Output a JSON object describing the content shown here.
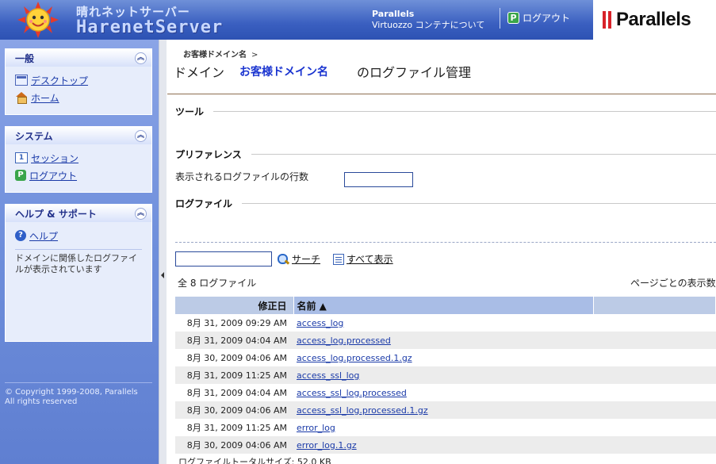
{
  "header": {
    "brand_ja": "晴れネットサーバー",
    "brand_en": "HarenetServer",
    "product_name": "Parallels",
    "about_text": "Virtuozzo コンテナについて",
    "logout_label": "ログアウト",
    "vendor_logo": "Parallels",
    "colors": {
      "header_blue": "#3a5fc0",
      "vendor_red": "#d8232a"
    }
  },
  "sidebar": {
    "panels": [
      {
        "title": "一般",
        "items": [
          {
            "label": "デスクトップ",
            "icon": "desktop-icon"
          },
          {
            "label": "ホーム",
            "icon": "home-icon"
          }
        ]
      },
      {
        "title": "システム",
        "items": [
          {
            "label": "セッション",
            "icon": "session-icon"
          },
          {
            "label": "ログアウト",
            "icon": "logout-icon"
          }
        ]
      },
      {
        "title": "ヘルプ & サポート",
        "items": [
          {
            "label": "ヘルプ",
            "icon": "help-icon"
          }
        ],
        "help_text": "ドメインに関係したログファイルが表示されています"
      }
    ],
    "copyright": "© Copyright 1999-2008, Parallels\nAll rights reserved"
  },
  "main": {
    "breadcrumb": {
      "item": "お客様ドメイン名",
      "separator": ">"
    },
    "title": {
      "prefix": "ドメイン",
      "domain": "お客様ドメイン名",
      "suffix": "のログファイル管理"
    },
    "sections": {
      "tools": "ツール",
      "preferences": "プリファレンス",
      "logfiles": "ログファイル"
    },
    "preferences": {
      "line_count_label": "表示されるログファイルの行数",
      "line_count_value": ""
    },
    "search": {
      "input_value": "",
      "search_label": "サーチ",
      "show_all_label": "すべて表示"
    },
    "total_count": "全 8 ログファイル",
    "per_page_label": "ページごとの表示数:",
    "table": {
      "columns": {
        "date": "修正日",
        "name": "名前 ▲"
      },
      "rows": [
        {
          "date": "8月 31, 2009 09:29 AM",
          "name": "access_log"
        },
        {
          "date": "8月 31, 2009 04:04 AM",
          "name": "access_log.processed"
        },
        {
          "date": "8月 30, 2009 04:06 AM",
          "name": "access_log.processed.1.gz"
        },
        {
          "date": "8月 31, 2009 11:25 AM",
          "name": "access_ssl_log"
        },
        {
          "date": "8月 31, 2009 04:04 AM",
          "name": "access_ssl_log.processed"
        },
        {
          "date": "8月 30, 2009 04:06 AM",
          "name": "access_ssl_log.processed.1.gz"
        },
        {
          "date": "8月 31, 2009 11:25 AM",
          "name": "error_log"
        },
        {
          "date": "8月 30, 2009 04:06 AM",
          "name": "error_log.1.gz"
        }
      ]
    },
    "total_size": "ログファイルトータルサイズ: 52.0 KB"
  }
}
